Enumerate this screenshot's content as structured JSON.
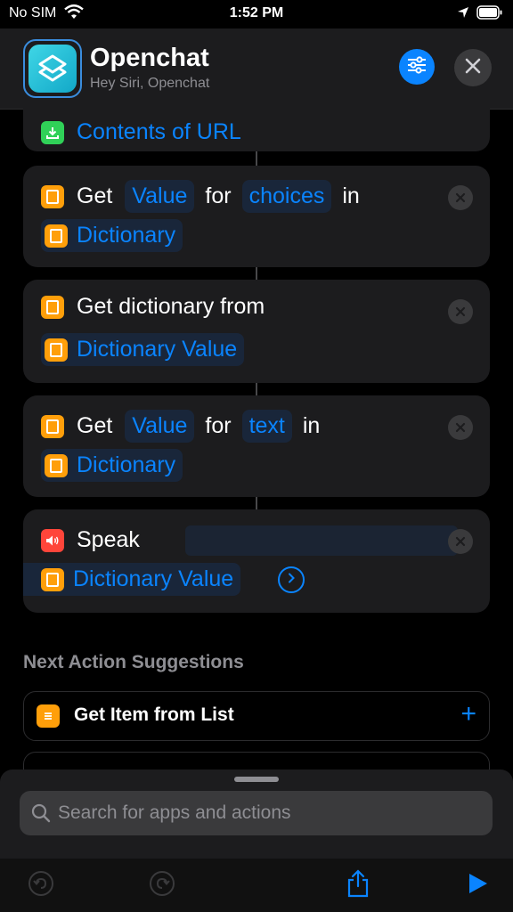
{
  "status": {
    "carrier": "No SIM",
    "time": "1:52 PM"
  },
  "header": {
    "title": "Openchat",
    "subtitle": "Hey Siri, Openchat"
  },
  "actions": {
    "contents_url": {
      "label": "Contents of URL"
    },
    "get_value_choices": {
      "verb": "Get",
      "token1": "Value",
      "for": "for",
      "key": "choices",
      "in": "in",
      "source": "Dictionary"
    },
    "get_dict": {
      "text": "Get dictionary from",
      "source": "Dictionary Value"
    },
    "get_value_text": {
      "verb": "Get",
      "token1": "Value",
      "for": "for",
      "key": "text",
      "in": "in",
      "source": "Dictionary"
    },
    "speak": {
      "verb": "Speak",
      "source": "Dictionary Value"
    }
  },
  "suggestions": {
    "title": "Next Action Suggestions",
    "items": [
      {
        "label": "Get Item from List"
      }
    ]
  },
  "search": {
    "placeholder": "Search for apps and actions"
  },
  "colors": {
    "accent": "#0a84ff",
    "scripting": "#ff9f0a",
    "web": "#30d158",
    "speak": "#ff453a"
  }
}
